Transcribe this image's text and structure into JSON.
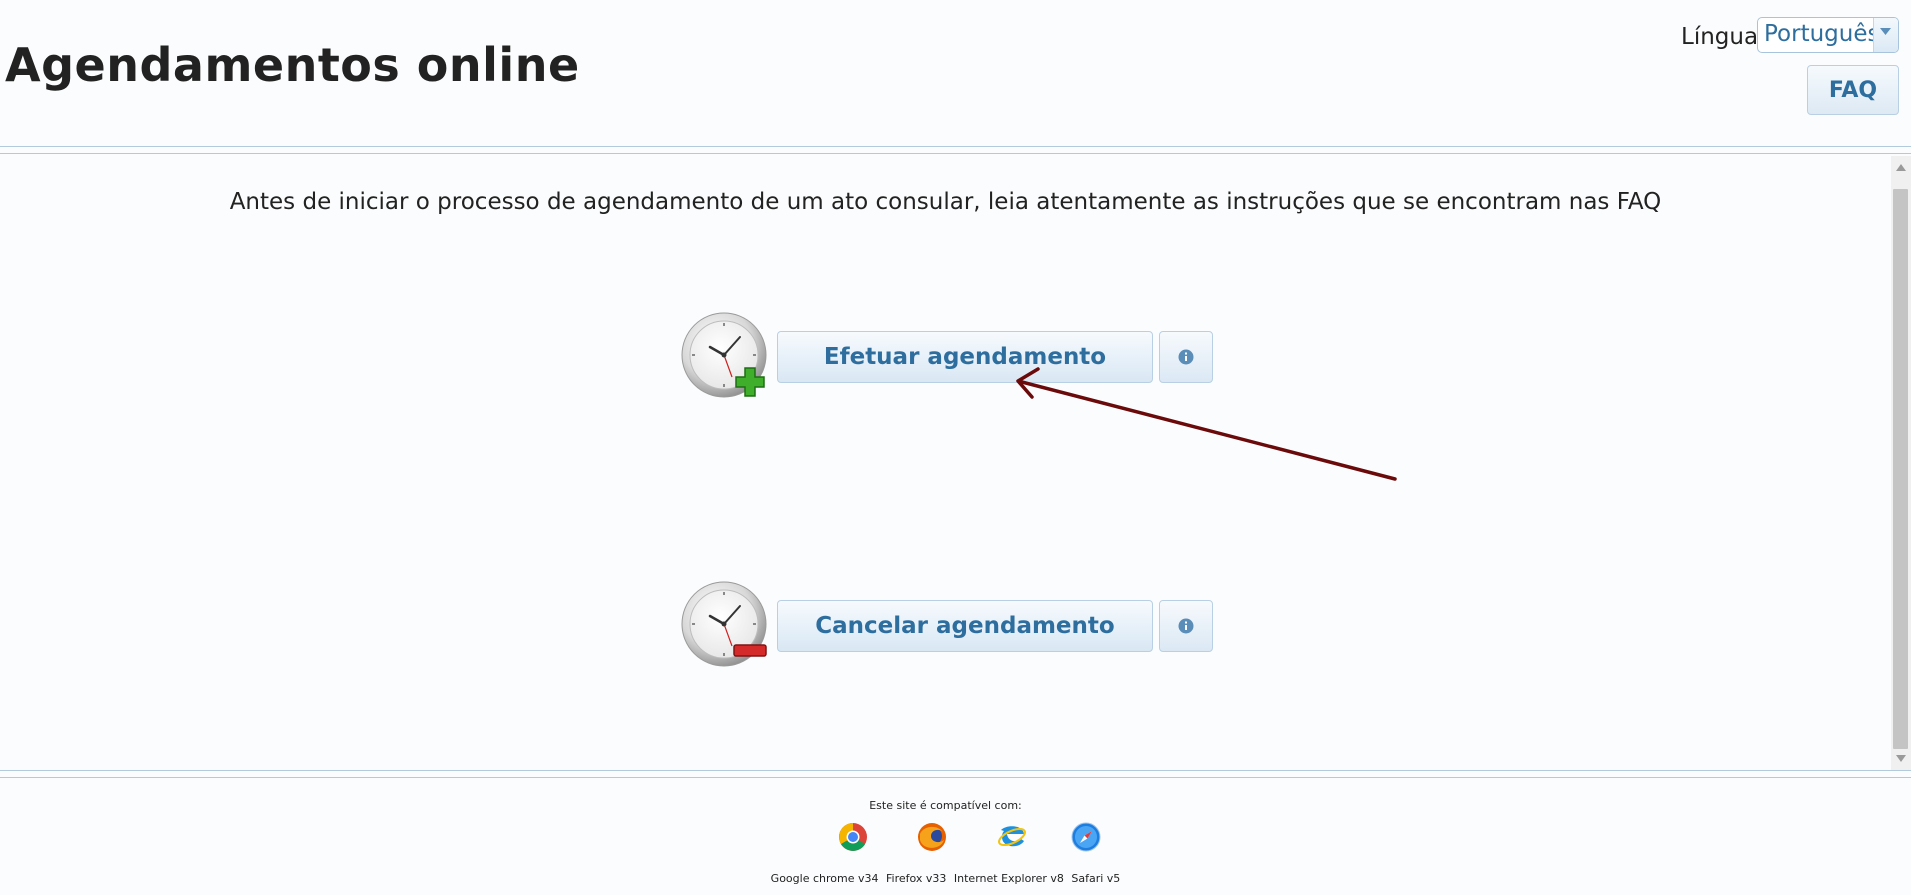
{
  "header": {
    "title": "Agendamentos online",
    "language_label": "Língua",
    "language_selected": "Português",
    "faq_label": "FAQ"
  },
  "main": {
    "instructions": "Antes de iniciar o processo de agendamento de um ato consular, leia atentamente as instruções que se encontram nas FAQ",
    "actions": [
      {
        "label": "Efetuar agendamento",
        "icon": "clock-add-icon",
        "badge_color": "#3fae2a"
      },
      {
        "label": "Cancelar agendamento",
        "icon": "clock-remove-icon",
        "badge_color": "#d42a2a"
      }
    ],
    "annotation_color": "#6b0a0a"
  },
  "footer": {
    "compat_title": "Este site é compatível com:",
    "browsers": [
      {
        "label": "Google chrome v34",
        "icon": "chrome-icon"
      },
      {
        "label": "Firefox v33",
        "icon": "firefox-icon"
      },
      {
        "label": "Internet Explorer v8",
        "icon": "internet-explorer-icon"
      },
      {
        "label": "Safari v5",
        "icon": "safari-icon"
      }
    ]
  },
  "colors": {
    "accent_text": "#2e6e9e",
    "border": "#b9d0e4",
    "background": "#fbfcfd"
  }
}
